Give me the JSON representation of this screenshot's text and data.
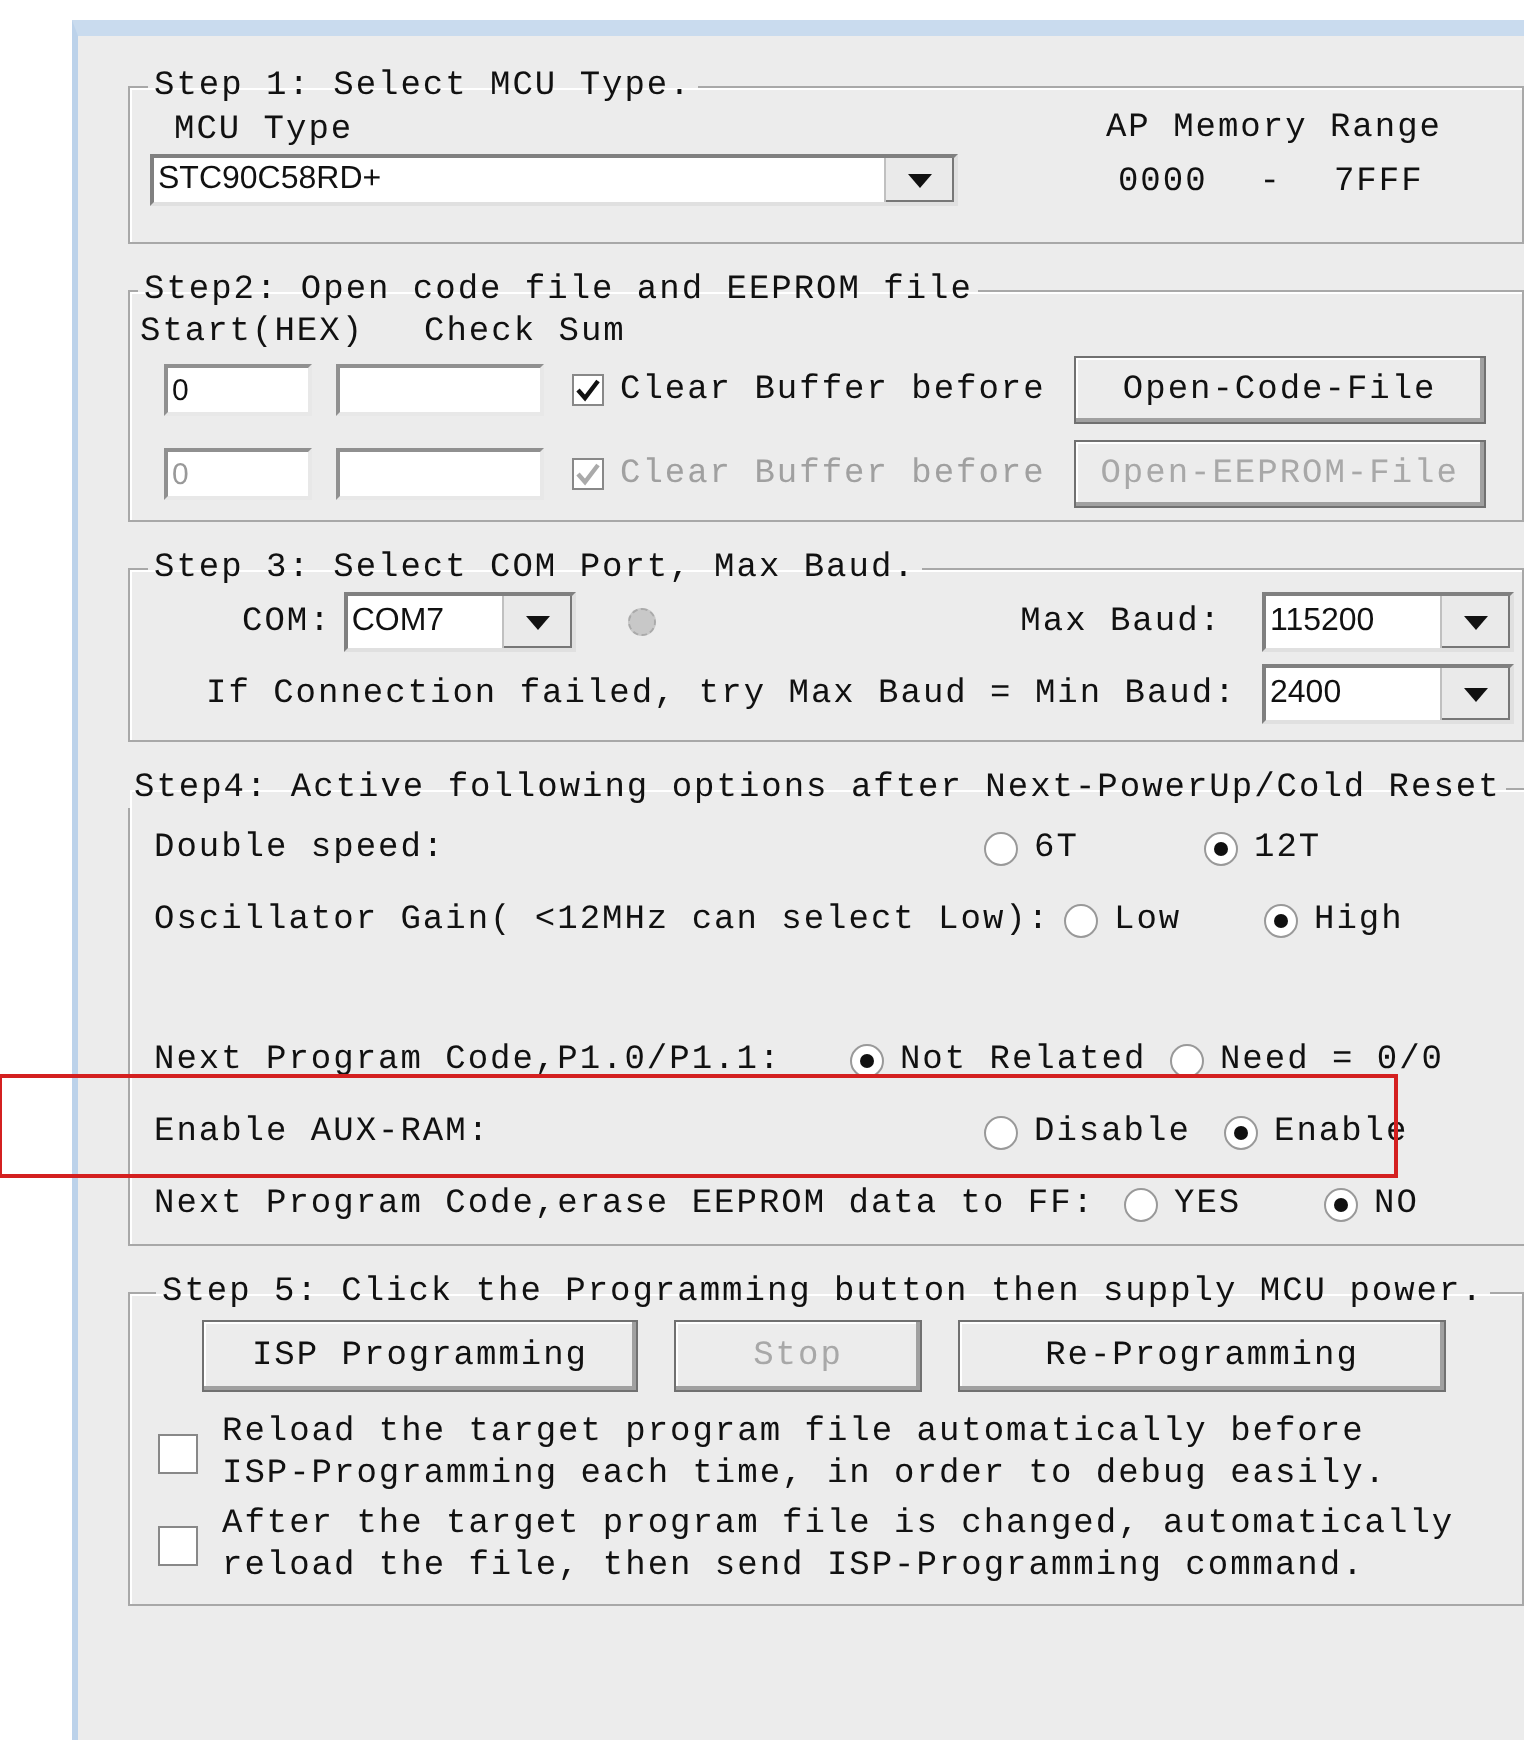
{
  "step1": {
    "title": "Step 1: Select MCU Type.",
    "mcu_label": "MCU Type",
    "mcu_value": "STC90C58RD+",
    "range_label": "AP Memory Range",
    "range_start": "0000",
    "range_sep": "-",
    "range_end": "7FFF"
  },
  "step2": {
    "title": "Step2: Open code file and EEPROM file",
    "columns": [
      "Start(HEX)",
      "Check Sum"
    ],
    "rows": [
      {
        "start": "0",
        "checked": true,
        "disabled": false,
        "check_label": "Clear Buffer before",
        "button": "Open-Code-File"
      },
      {
        "start": "0",
        "checked": true,
        "disabled": true,
        "check_label": "Clear Buffer before",
        "button": "Open-EEPROM-File"
      }
    ]
  },
  "step3": {
    "title": "Step 3: Select COM Port, Max Baud.",
    "com_label": "COM:",
    "com_value": "COM7",
    "max_baud_label": "Max Baud:",
    "max_baud_value": "115200",
    "min_baud_label": "If Connection failed, try Max Baud = Min Baud:",
    "min_baud_value": "2400"
  },
  "step4": {
    "title": "Step4: Active following options after Next-PowerUp/Cold Reset",
    "options": [
      {
        "label": "Double speed:",
        "gap_before": false,
        "highlighted": false,
        "choices": [
          {
            "label": "6T",
            "selected": false
          },
          {
            "label": "12T",
            "selected": true
          }
        ]
      },
      {
        "label": "Oscillator Gain( <12MHz can select Low):",
        "gap_before": false,
        "highlighted": false,
        "choices": [
          {
            "label": "Low",
            "selected": false
          },
          {
            "label": "High",
            "selected": true
          }
        ]
      },
      {
        "label": "Next Program Code,P1.0/P1.1:",
        "gap_before": true,
        "highlighted": false,
        "choices": [
          {
            "label": "Not Related",
            "selected": true
          },
          {
            "label": "Need = 0/0",
            "selected": false
          }
        ]
      },
      {
        "label": "Enable AUX-RAM:",
        "gap_before": false,
        "highlighted": true,
        "choices": [
          {
            "label": "Disable",
            "selected": false
          },
          {
            "label": "Enable",
            "selected": true
          }
        ]
      },
      {
        "label": "Next Program Code,erase EEPROM data to FF:",
        "gap_before": false,
        "highlighted": false,
        "choices": [
          {
            "label": "YES",
            "selected": false
          },
          {
            "label": "NO",
            "selected": true
          }
        ]
      }
    ]
  },
  "step5": {
    "title": "Step 5: Click the Programming button then supply MCU power.",
    "buttons": [
      {
        "label": "ISP Programming",
        "disabled": false
      },
      {
        "label": "Stop",
        "disabled": true
      },
      {
        "label": "Re-Programming",
        "disabled": false
      }
    ],
    "checkboxes": [
      {
        "checked": false,
        "lines": [
          "Reload the target program file automatically before",
          "ISP-Programming each time, in order to debug easily."
        ]
      },
      {
        "checked": false,
        "lines": [
          "After the target program file is changed, automatically",
          "reload the file, then send ISP-Programming command."
        ]
      }
    ]
  }
}
